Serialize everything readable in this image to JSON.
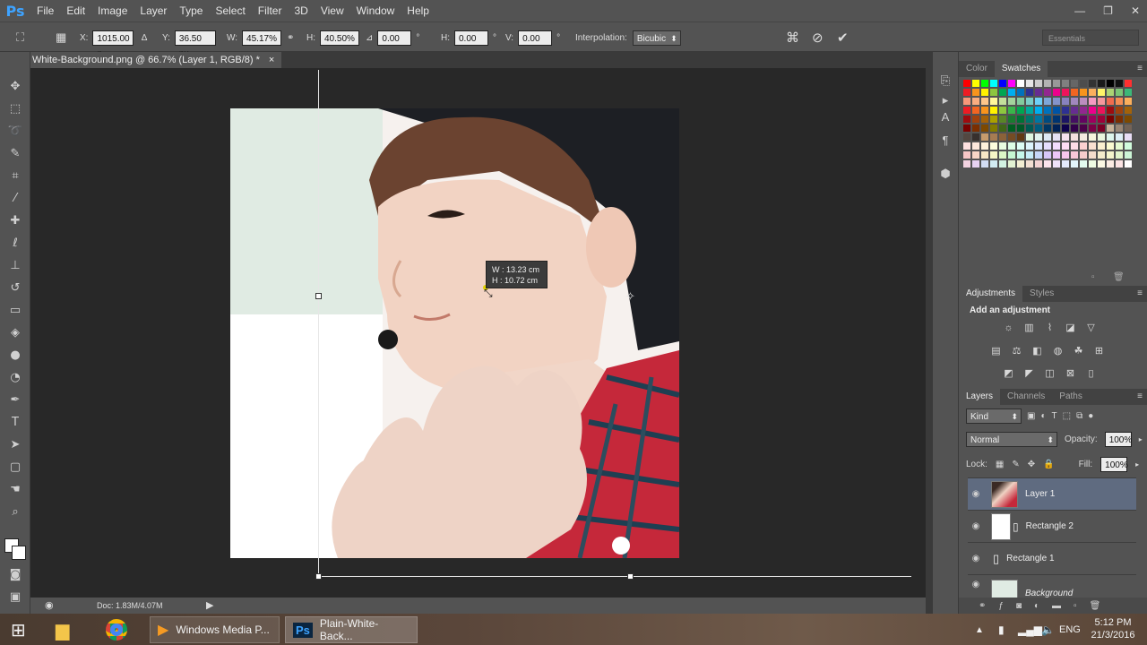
{
  "app": {
    "logo": "Ps",
    "menu": [
      "File",
      "Edit",
      "Image",
      "Layer",
      "Type",
      "Select",
      "Filter",
      "3D",
      "View",
      "Window",
      "Help"
    ],
    "window_controls": [
      "—",
      "❐",
      "✕"
    ]
  },
  "options": {
    "x_label": "X:",
    "x_value": "1015.00 p",
    "y_label": "Y:",
    "y_value": "36.50 px",
    "w_label": "W:",
    "w_value": "45.17%",
    "h_label": "H:",
    "h_value": "40.50%",
    "angle_value": "0.00",
    "deg": "°",
    "hskew_label": "H:",
    "hskew_value": "0.00",
    "vskew_label": "V:",
    "vskew_value": "0.00",
    "interp_label": "Interpolation:",
    "interp_value": "Bicubic",
    "workspace": "Essentials"
  },
  "document": {
    "tab_title": "White-Background.png @ 66.7% (Layer 1, RGB/8) *",
    "tab_close": "×",
    "status_doc": "Doc: 1.83M/4.07M"
  },
  "transform_tooltip": {
    "w": "W :   13.23 cm",
    "h": "H :   10.72 cm"
  },
  "panels": {
    "color_tabs": [
      "Color",
      "Swatches"
    ],
    "adjust_tabs": [
      "Adjustments",
      "Styles"
    ],
    "adjust_title": "Add an adjustment",
    "layers_tabs": [
      "Layers",
      "Channels",
      "Paths"
    ],
    "kind": "Kind",
    "blend_mode": "Normal",
    "opacity_label": "Opacity:",
    "opacity_value": "100%",
    "lock_label": "Lock:",
    "fill_label": "Fill:",
    "fill_value": "100%",
    "layers": [
      {
        "name": "Layer 1",
        "selected": true
      },
      {
        "name": "Rectangle 2",
        "selected": false
      },
      {
        "name": "Rectangle 1",
        "selected": false
      },
      {
        "name": "Background",
        "selected": false
      }
    ],
    "swatch_colors": [
      "#ff0000",
      "#ffff00",
      "#00ff00",
      "#00ffff",
      "#0000ff",
      "#ff00ff",
      "#ffffff",
      "#e6e6e6",
      "#cccccc",
      "#b3b3b3",
      "#999999",
      "#808080",
      "#666666",
      "#4d4d4d",
      "#333333",
      "#1a1a1a",
      "#000000",
      "#111111",
      "#ff3030",
      "#ed1c24",
      "#f7941d",
      "#fff200",
      "#8dc63f",
      "#00a651",
      "#00aeef",
      "#0072bc",
      "#2e3192",
      "#662d91",
      "#92278f",
      "#ec008c",
      "#ed145b",
      "#f26522",
      "#f7941d",
      "#fbaf5d",
      "#fff568",
      "#acd373",
      "#7cc576",
      "#3cb878",
      "#f7977a",
      "#f9ad81",
      "#fdc68a",
      "#fff79a",
      "#c4df9b",
      "#a3d39c",
      "#82ca9d",
      "#7bcdc8",
      "#6ecff6",
      "#7ea7d8",
      "#8493ca",
      "#8882be",
      "#a187be",
      "#bc8dbf",
      "#f49ac2",
      "#f6989d",
      "#f26c4f",
      "#f68e55",
      "#fbaf5c",
      "#ed1c24",
      "#f26522",
      "#f7941d",
      "#fff200",
      "#8dc63f",
      "#39b54a",
      "#00a651",
      "#00a99d",
      "#00aeef",
      "#0072bc",
      "#0054a6",
      "#2e3192",
      "#662d91",
      "#92278f",
      "#ec008c",
      "#ed145b",
      "#9e0b0f",
      "#a0410d",
      "#a36209",
      "#9e0b0f",
      "#a0410d",
      "#a36209",
      "#aba000",
      "#598527",
      "#1a7b30",
      "#007236",
      "#00746b",
      "#0076a3",
      "#004b80",
      "#003471",
      "#1b1464",
      "#440e62",
      "#630460",
      "#9e005d",
      "#9e0039",
      "#790000",
      "#7b2e00",
      "#7d4900",
      "#790000",
      "#7b2e00",
      "#7d4900",
      "#827b00",
      "#406618",
      "#005e20",
      "#005826",
      "#005952",
      "#005b7f",
      "#003663",
      "#002157",
      "#0d004c",
      "#32004b",
      "#4b0049",
      "#7b0046",
      "#7a0026",
      "#c7b299",
      "#998675",
      "#736357",
      "#534741",
      "#37302d",
      "#c69c6d",
      "#a67c52",
      "#8c6239",
      "#754c24",
      "#603913",
      "#ddf5e0",
      "#e0f2f0",
      "#dde8f5",
      "#e6e0f5",
      "#f5e0ee",
      "#f5e0e0",
      "#f5ece0",
      "#f5f5dd",
      "#e8f5dd",
      "#ddf5ec",
      "#ddeef5",
      "#e8ddf5",
      "#fde0e0",
      "#fde8dd",
      "#fdf2dd",
      "#fdfddd",
      "#eafde0",
      "#ddfde6",
      "#ddfdf6",
      "#ddf4fd",
      "#dde6fd",
      "#e6ddfd",
      "#f4ddfd",
      "#fdddf4",
      "#fddde6",
      "#fbd0d0",
      "#fbe0d0",
      "#fbf0d0",
      "#fbfbd0",
      "#e6fbd0",
      "#d0fbdc",
      "#f7c6c6",
      "#f7d6c6",
      "#f7e8c6",
      "#f7f7c6",
      "#ddf7c6",
      "#c6f7d2",
      "#c6f7ea",
      "#c6ecf7",
      "#c6d6f7",
      "#d6c6f7",
      "#ecc6f7",
      "#f7c6ec",
      "#f7c6d6",
      "#f5cccc",
      "#f5dccc",
      "#f5eccc",
      "#f5f5cc",
      "#e2f5cc",
      "#ccf5d6",
      "#f2d2e0",
      "#e8d2f2",
      "#d2dcf2",
      "#d2ecf2",
      "#d2f2e2",
      "#e2f2d2",
      "#f2eed2",
      "#f2dfd2",
      "#f2d2d2",
      "#fbe3ec",
      "#efe3fb",
      "#e3e9fb",
      "#e3f5fb",
      "#e3fbef",
      "#effbe3",
      "#fbf8e3",
      "#fbece3",
      "#fbe3e3",
      "#ffffff"
    ]
  },
  "taskbar": {
    "items": [
      "Windows Media P...",
      "Plain-White-Back..."
    ],
    "lang": "ENG",
    "time": "5:12 PM",
    "date": "21/3/2016"
  },
  "icons": {
    "move": "✥",
    "marquee": "⬚",
    "lasso": "➰",
    "quick": "✎",
    "crop": "⌗",
    "eyedrop": "💧",
    "brush": "🖌",
    "type": "T",
    "hand": "✋",
    "zoom": "🔍"
  }
}
